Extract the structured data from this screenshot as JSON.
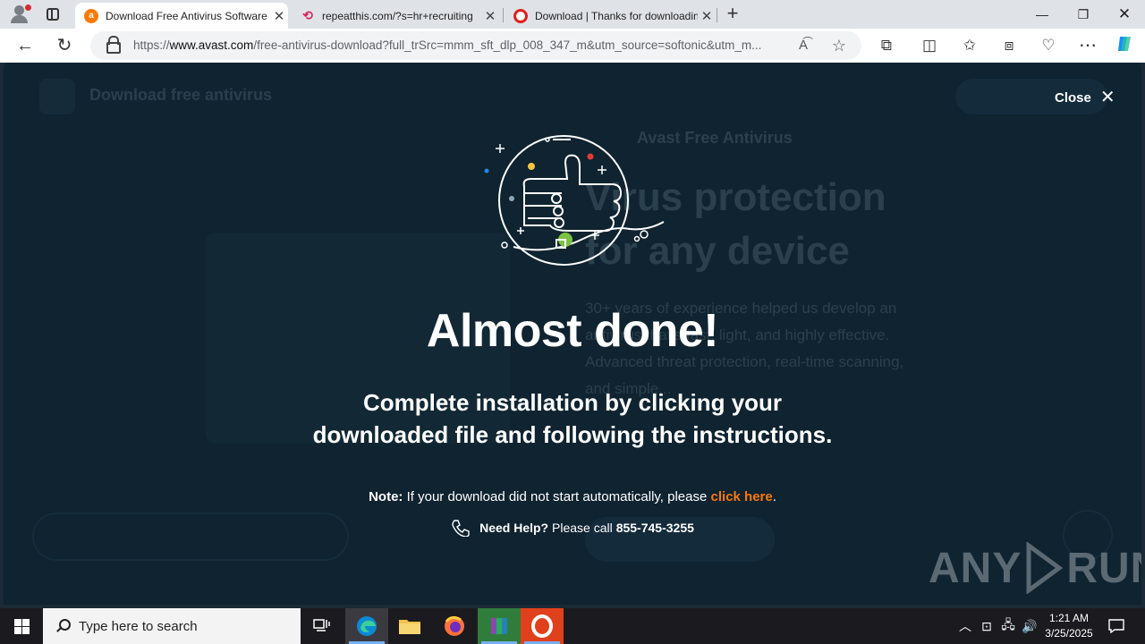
{
  "browser": {
    "tabs": [
      {
        "title": "Download Free Antivirus Software",
        "active": true,
        "favicon": "avast-icon"
      },
      {
        "title": "repeatthis.com/?s=hr+recruiting",
        "active": false,
        "favicon": "repeat-icon"
      },
      {
        "title": "Download | Thanks for downloading",
        "active": false,
        "favicon": "opera-icon"
      }
    ],
    "new_tab_label": "+",
    "url_prefix": "https://",
    "url_host": "www.avast.com",
    "url_path": "/free-antivirus-download?full_trSrc=mmm_sft_dlp_008_347_m&utm_source=softonic&utm_m..."
  },
  "background_page": {
    "header_title": "Download free antivirus",
    "brand_name": "Avast Free Antivirus",
    "hero_line1": "Virus protection",
    "hero_line2": "for any device",
    "body_text": "30+ years of experience helped us develop an antivirus that's fast, light, and highly effective. Advanced threat protection, real-time scanning, and simple..."
  },
  "overlay": {
    "close_label": "Close",
    "headline": "Almost done!",
    "subline_1": "Complete installation by clicking your",
    "subline_2": "downloaded file and following the instructions.",
    "note_label": "Note:",
    "note_text": "If your download did not start automatically, please",
    "note_link": "click here",
    "note_end": ".",
    "help_label": "Need Help?",
    "help_text": "Please call",
    "help_number": "855-745-3255"
  },
  "watermark": {
    "left": "ANY",
    "right": "RUN"
  },
  "taskbar": {
    "search_placeholder": "Type here to search",
    "time": "1:21 AM",
    "date": "3/25/2025"
  },
  "colors": {
    "overlay_bg": "#0f2330",
    "link_orange": "#ff7800",
    "avast_orange": "#ff7800",
    "accent_blue": "#0078d4"
  }
}
